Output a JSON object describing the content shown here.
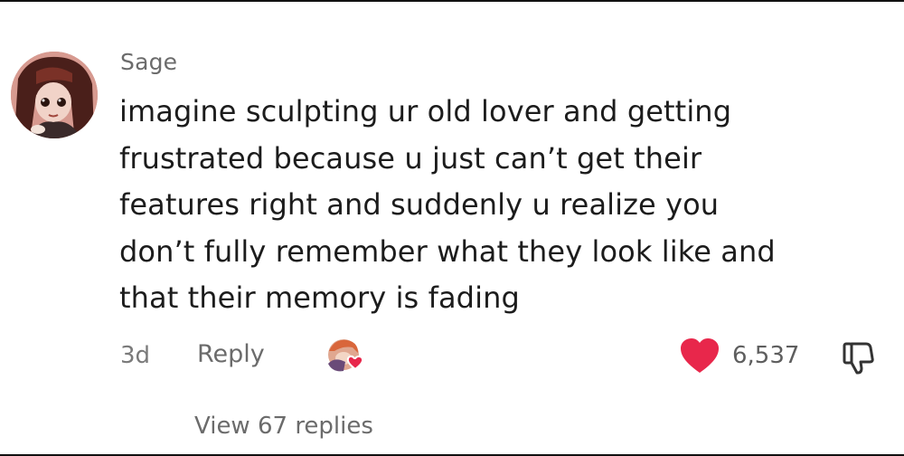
{
  "comment": {
    "author": "Sage",
    "text": "imagine sculpting ur old lover and getting\nfrustrated because u just can’t get their\nfeatures right and suddenly u realize you\ndon’t fully remember what they look like and\nthat their memory is fading",
    "timestamp": "3d",
    "reply_label": "Reply",
    "like_count": "6,537",
    "view_replies_label": "View 67 replies"
  },
  "icons": {
    "avatar": "user-avatar",
    "creator_liked": "creator-liked-avatar-icon",
    "like": "heart-icon",
    "dislike": "thumbs-down-icon"
  },
  "colors": {
    "like_heart": "#e8274b",
    "meta_text": "#6b6b6b",
    "body_text": "#1c1c1c"
  }
}
